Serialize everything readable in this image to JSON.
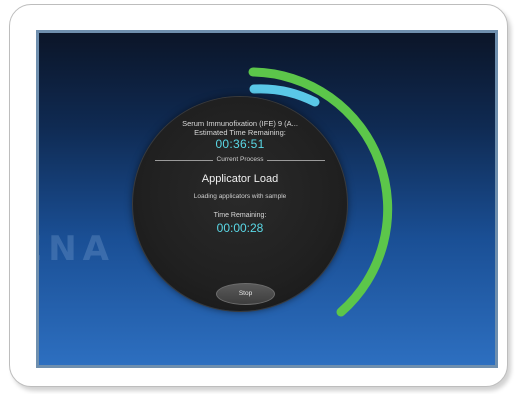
{
  "background_text": "ENA                        ATORI",
  "job": {
    "name": "Serum Immunofixation (IFE) 9 (A...",
    "estimated_label": "Estimated Time Remaining:",
    "estimated_time": "00:36:51"
  },
  "current_process": {
    "section_label": "Current Process",
    "name": "Applicator Load",
    "description": "Loading applicators with sample",
    "time_label": "Time Remaining:",
    "time_remaining": "00:00:28"
  },
  "controls": {
    "stop_label": "Stop"
  },
  "colors": {
    "overall_progress_arc": "#5cc64a",
    "step_progress_arc": "#5ac8e8",
    "timer_text": "#5ad8e6",
    "dial_background": "#222222"
  }
}
